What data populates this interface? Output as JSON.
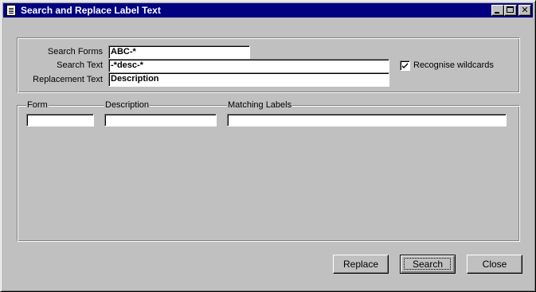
{
  "window": {
    "title": "Search and Replace Label Text",
    "icon": "document-icon",
    "controls": {
      "minimize": "minimize-icon",
      "maximize": "maximize-icon",
      "close": "close-icon"
    }
  },
  "search": {
    "forms_label": "Search Forms",
    "forms_value": "ABC-*",
    "text_label": "Search Text",
    "text_value": "-*desc-*",
    "replacement_label": "Replacement Text",
    "replacement_value": "Description",
    "wildcards_label": "Recognise wildcards",
    "wildcards_checked": true
  },
  "results": {
    "columns": [
      "Form",
      "Description",
      "Matching Labels"
    ],
    "rows": [
      [
        "",
        "",
        ""
      ]
    ]
  },
  "buttons": {
    "replace": "Replace",
    "search": "Search",
    "close": "Close"
  }
}
